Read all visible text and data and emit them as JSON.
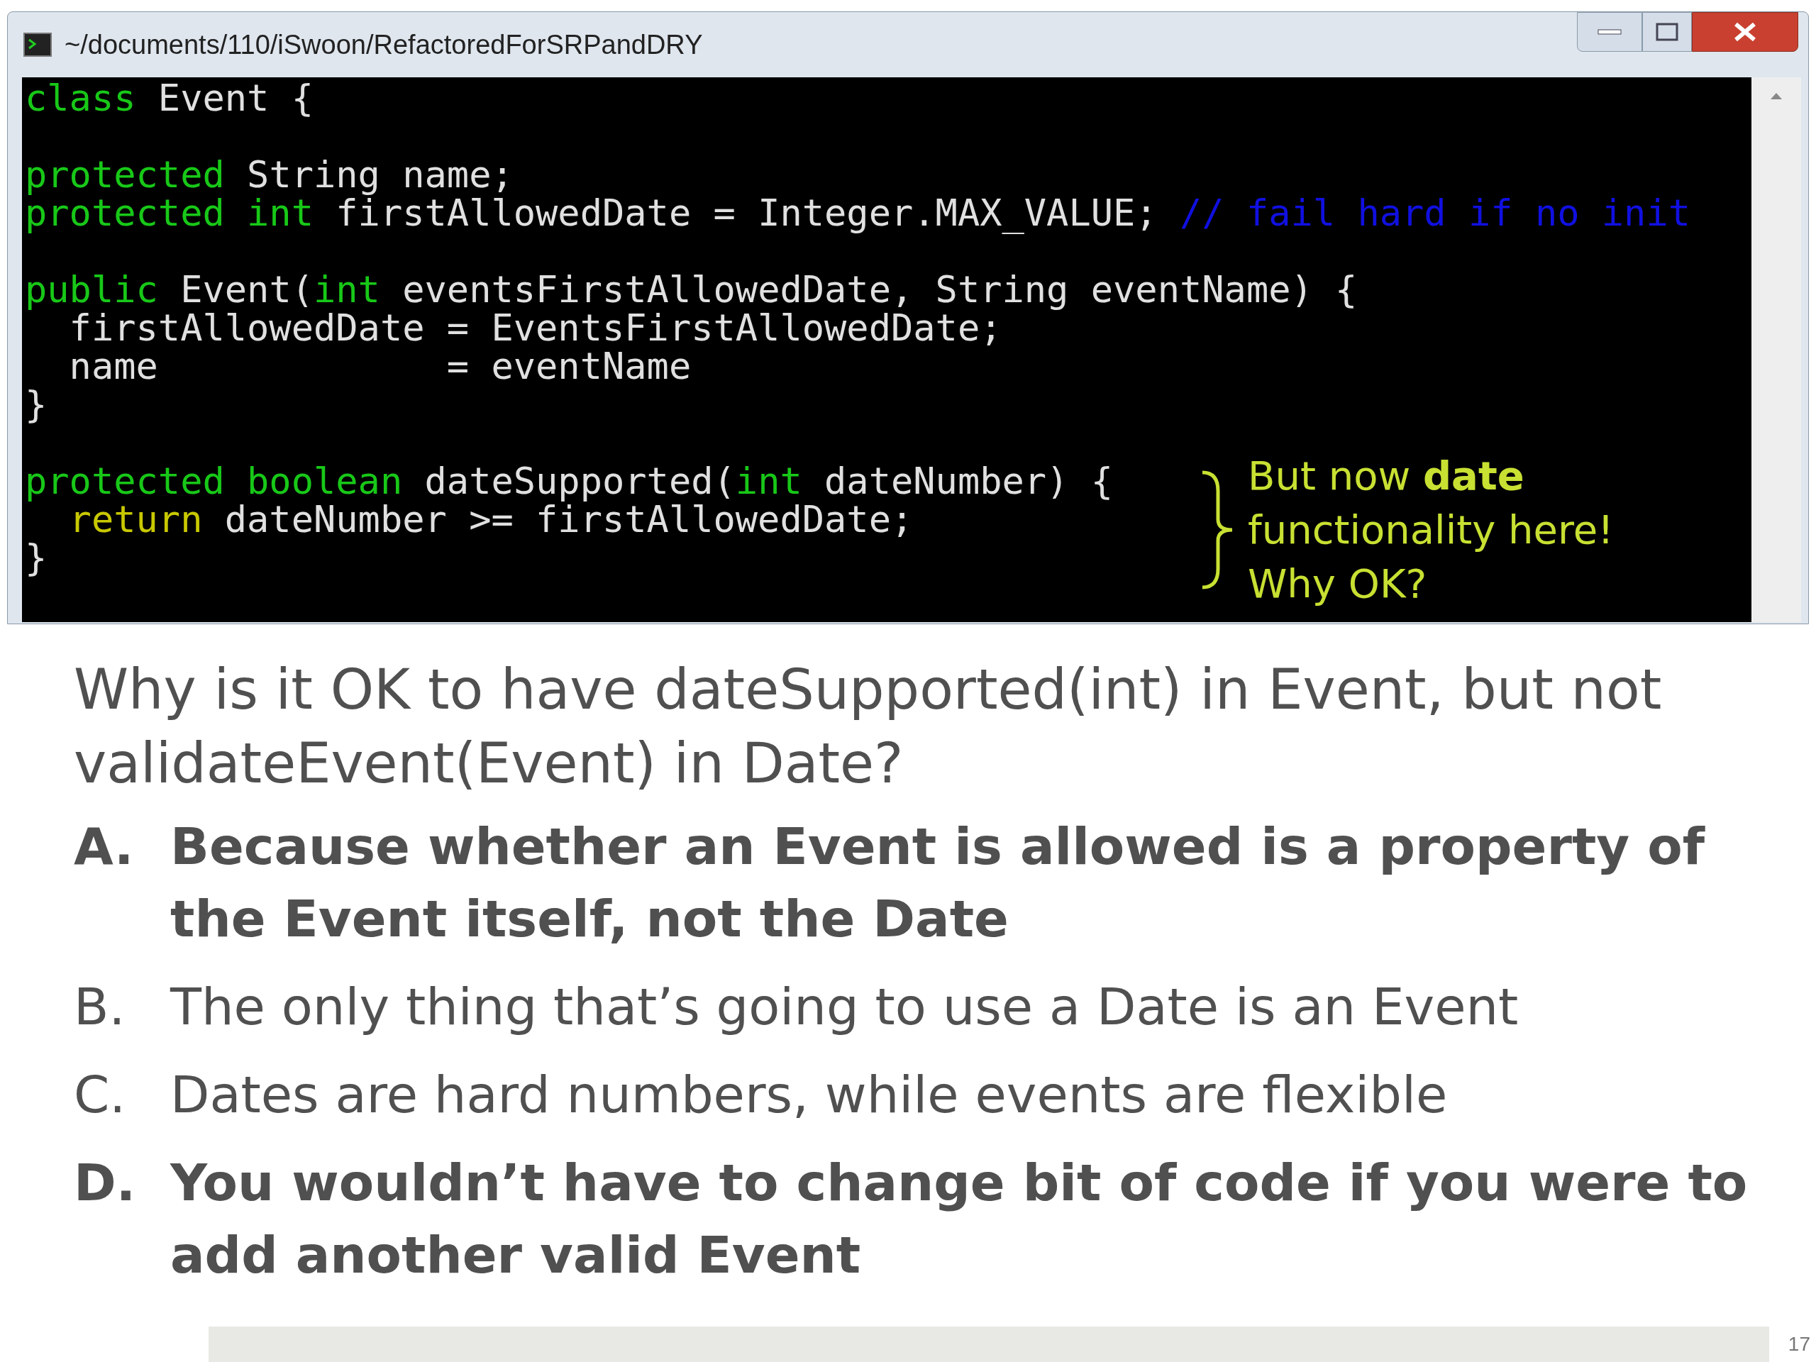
{
  "window": {
    "title": "~/documents/110/iSwoon/RefactoredForSRPandDRY"
  },
  "code_lines": [
    {
      "kind": "code",
      "tokens": [
        {
          "kind": "keyword",
          "text": "class"
        },
        {
          "kind": "plain",
          "text": " Event {"
        }
      ]
    },
    {
      "kind": "blank"
    },
    {
      "kind": "code",
      "tokens": [
        {
          "kind": "keyword",
          "text": "protected"
        },
        {
          "kind": "plain",
          "text": " String name;"
        }
      ]
    },
    {
      "kind": "code",
      "tokens": [
        {
          "kind": "keyword",
          "text": "protected int"
        },
        {
          "kind": "plain",
          "text": " firstAllowedDate = Integer.MAX_VALUE; "
        },
        {
          "kind": "comment",
          "text": "// fail hard if no init"
        }
      ]
    },
    {
      "kind": "blank"
    },
    {
      "kind": "code",
      "tokens": [
        {
          "kind": "keyword",
          "text": "public"
        },
        {
          "kind": "plain",
          "text": " Event("
        },
        {
          "kind": "keyword",
          "text": "int"
        },
        {
          "kind": "plain",
          "text": " eventsFirstAllowedDate, String eventName) {"
        }
      ]
    },
    {
      "kind": "code",
      "tokens": [
        {
          "kind": "plain",
          "text": "  firstAllowedDate = EventsFirstAllowedDate;"
        }
      ]
    },
    {
      "kind": "code",
      "tokens": [
        {
          "kind": "plain",
          "text": "  name             = eventName"
        }
      ]
    },
    {
      "kind": "code",
      "tokens": [
        {
          "kind": "plain",
          "text": "}"
        }
      ]
    },
    {
      "kind": "blank"
    },
    {
      "kind": "code",
      "tokens": [
        {
          "kind": "keyword",
          "text": "protected boolean"
        },
        {
          "kind": "plain",
          "text": " dateSupported("
        },
        {
          "kind": "keyword",
          "text": "int"
        },
        {
          "kind": "plain",
          "text": " dateNumber) {"
        }
      ]
    },
    {
      "kind": "code",
      "tokens": [
        {
          "kind": "control",
          "text": "  return"
        },
        {
          "kind": "plain",
          "text": " dateNumber >= firstAllowedDate;"
        }
      ]
    },
    {
      "kind": "code",
      "tokens": [
        {
          "kind": "plain",
          "text": "}"
        }
      ]
    }
  ],
  "annotation": "But now **date** functionality here! Why OK?",
  "question": "Why is it OK to have dateSupported(int) in Event, but not validateEvent(Event) in Date?",
  "options": [
    {
      "letter": "A.",
      "text": "Because whether an Event is allowed is a property of the Event itself, not the Date",
      "bold": true
    },
    {
      "letter": "B.",
      "text": "The only thing that’s going to use a Date is an Event",
      "bold": false
    },
    {
      "letter": "C.",
      "text": "Dates are hard numbers, while events are flexible",
      "bold": false
    },
    {
      "letter": "D.",
      "text": "You wouldn’t have to change bit of code if you were to add another valid Event",
      "bold": true
    }
  ],
  "page_number": "17"
}
